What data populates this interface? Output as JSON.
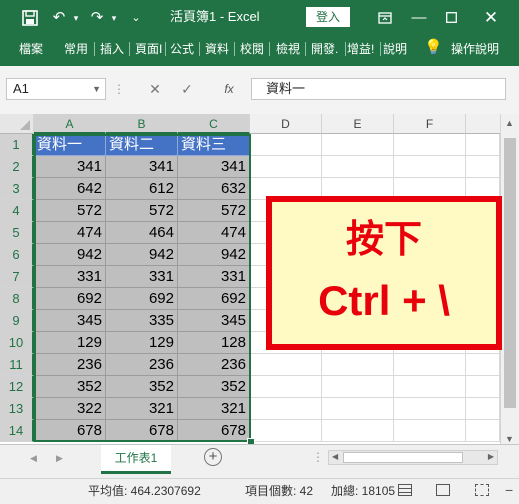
{
  "titlebar": {
    "title": "活頁簿1 - Excel",
    "signin": "登入",
    "icons": [
      "save-icon",
      "undo-icon",
      "redo-icon",
      "customize-icon",
      "ribbon-display-icon",
      "minimize-icon",
      "restore-icon",
      "close-icon"
    ]
  },
  "ribbon": {
    "tabs": [
      "檔案",
      "常用",
      "插入",
      "頁面I",
      "公式",
      "資料",
      "校閱",
      "檢視",
      "開發.",
      "增益!",
      "說明",
      "操作說明"
    ]
  },
  "formula_bar": {
    "name_box": "A1",
    "fx": "fx",
    "formula": "資料一"
  },
  "sheet": {
    "columns": [
      "A",
      "B",
      "C",
      "D",
      "E",
      "F"
    ],
    "rows": [
      "1",
      "2",
      "3",
      "4",
      "5",
      "6",
      "7",
      "8",
      "9",
      "10",
      "11",
      "12",
      "13",
      "14"
    ],
    "header_row": [
      "資料一",
      "資料二",
      "資料三"
    ],
    "data": [
      [
        "341",
        "341",
        "341"
      ],
      [
        "642",
        "612",
        "632"
      ],
      [
        "572",
        "572",
        "572"
      ],
      [
        "474",
        "464",
        "474"
      ],
      [
        "942",
        "942",
        "942"
      ],
      [
        "331",
        "331",
        "331"
      ],
      [
        "692",
        "692",
        "692"
      ],
      [
        "345",
        "335",
        "345"
      ],
      [
        "129",
        "129",
        "128"
      ],
      [
        "236",
        "236",
        "236"
      ],
      [
        "352",
        "352",
        "352"
      ],
      [
        "322",
        "321",
        "321"
      ],
      [
        "678",
        "678",
        "678"
      ]
    ]
  },
  "callout": {
    "line1": "按下",
    "line2": "Ctrl + \\"
  },
  "sheet_tabs": {
    "active": "工作表1"
  },
  "status": {
    "average": "平均值: 464.2307692",
    "count": "項目個數: 42",
    "sum": "加總: 18105"
  },
  "colors": {
    "excel_green": "#217346",
    "header_fill": "#4472c4",
    "data_fill": "#bfbfbf",
    "callout_red": "#e8000b",
    "callout_fill": "#fff9c4"
  }
}
